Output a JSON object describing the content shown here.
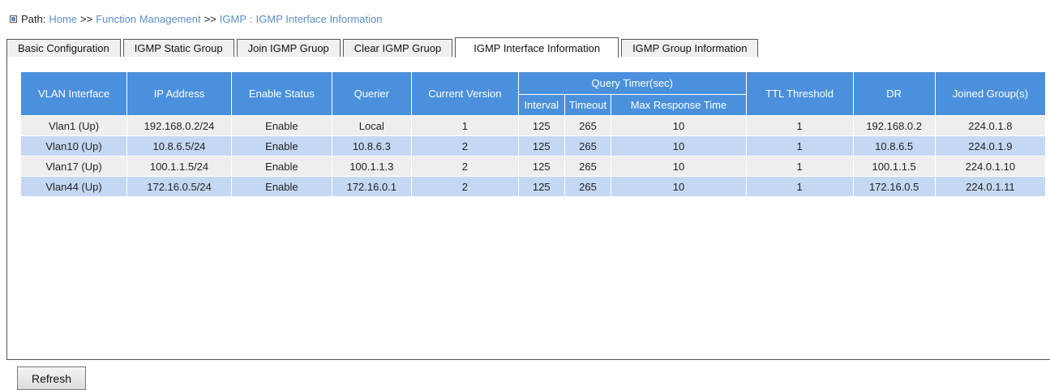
{
  "breadcrumb": {
    "label": "Path:",
    "items": [
      "Home",
      "Function Management",
      "IGMP",
      "IGMP Interface Information"
    ],
    "separators": [
      ">>",
      ">>",
      ":"
    ]
  },
  "tabs": [
    {
      "label": "Basic Configuration",
      "active": false
    },
    {
      "label": "IGMP Static Group",
      "active": false
    },
    {
      "label": "Join IGMP Gruop",
      "active": false
    },
    {
      "label": "Clear IGMP Gruop",
      "active": false
    },
    {
      "label": "IGMP Interface Information",
      "active": true
    },
    {
      "label": "IGMP Group Information",
      "active": false
    }
  ],
  "table": {
    "headers": {
      "vlan_interface": "VLAN Interface",
      "ip_address": "IP Address",
      "enable_status": "Enable Status",
      "querier": "Querier",
      "current_version": "Current Version",
      "query_timer": "Query Timer(sec)",
      "interval": "Interval",
      "timeout": "Timeout",
      "max_response_time": "Max Response Time",
      "ttl_threshold": "TTL Threshold",
      "dr": "DR",
      "joined_groups": "Joined Group(s)"
    },
    "rows": [
      [
        "Vlan1 (Up)",
        "192.168.0.2/24",
        "Enable",
        "Local",
        "1",
        "125",
        "265",
        "10",
        "1",
        "192.168.0.2",
        "224.0.1.8"
      ],
      [
        "Vlan10 (Up)",
        "10.8.6.5/24",
        "Enable",
        "10.8.6.3",
        "2",
        "125",
        "265",
        "10",
        "1",
        "10.8.6.5",
        "224.0.1.9"
      ],
      [
        "Vlan17 (Up)",
        "100.1.1.5/24",
        "Enable",
        "100.1.1.3",
        "2",
        "125",
        "265",
        "10",
        "1",
        "100.1.1.5",
        "224.0.1.10"
      ],
      [
        "Vlan44 (Up)",
        "172.16.0.5/24",
        "Enable",
        "172.16.0.1",
        "2",
        "125",
        "265",
        "10",
        "1",
        "172.16.0.5",
        "224.0.1.11"
      ]
    ]
  },
  "buttons": {
    "refresh": "Refresh"
  },
  "colors": {
    "header_bg": "#4a90dc",
    "row_odd": "#eeeeee",
    "row_even": "#c5d8f3",
    "link": "#5b8ec9"
  }
}
